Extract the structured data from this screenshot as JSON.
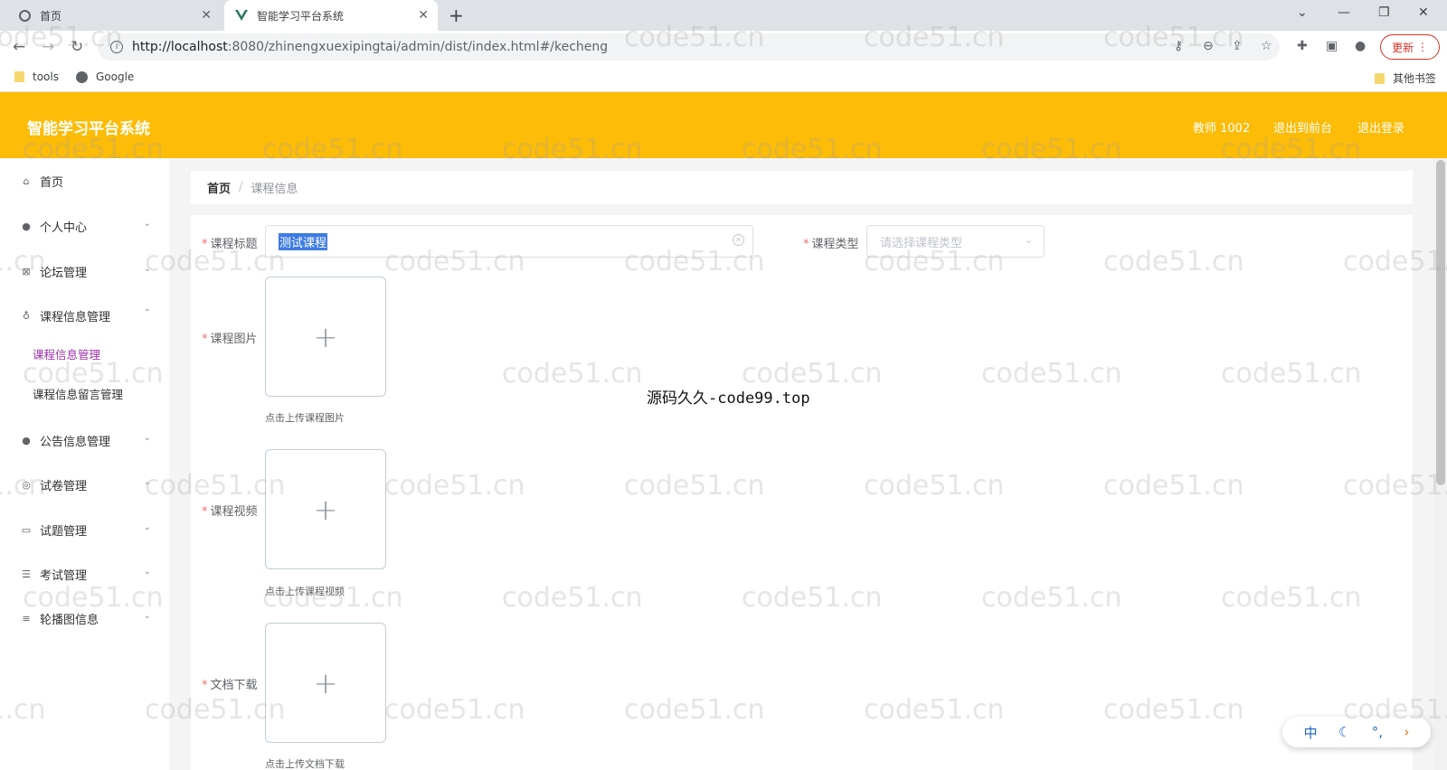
{
  "browser": {
    "tabs": [
      {
        "title": "首页"
      },
      {
        "title": "智能学习平台系统"
      }
    ],
    "url_host": "http://localhost",
    "url_path": ":8080/zhinengxuexipingtai/admin/dist/index.html#/kecheng",
    "update_label": "更新",
    "bookmarks": [
      {
        "label": "tools",
        "icon": "folder-icon"
      },
      {
        "label": "Google",
        "icon": "globe-icon"
      }
    ],
    "other_bookmarks": "其他书签"
  },
  "header": {
    "title": "智能学习平台系统",
    "user": "教师 1002",
    "to_front": "退出到前台",
    "logout": "退出登录",
    "bg_color": "#fcbc07"
  },
  "sidebar": {
    "items": [
      {
        "label": "首页",
        "icon": "home-icon"
      },
      {
        "label": "个人中心",
        "icon": "user-icon"
      },
      {
        "label": "论坛管理",
        "icon": "forum-icon"
      },
      {
        "label": "课程信息管理",
        "icon": "microphone-icon"
      },
      {
        "label": "公告信息管理",
        "icon": "user-icon"
      },
      {
        "label": "试卷管理",
        "icon": "document-icon"
      },
      {
        "label": "试题管理",
        "icon": "chat-icon"
      },
      {
        "label": "考试管理",
        "icon": "sliders-icon"
      },
      {
        "label": "轮播图信息",
        "icon": "list-icon"
      }
    ],
    "sub_items": [
      {
        "label": "课程信息管理"
      },
      {
        "label": "课程信息留言管理"
      }
    ]
  },
  "breadcrumb": {
    "home": "首页",
    "current": "课程信息"
  },
  "form": {
    "title_label": "课程标题",
    "title_value": "测试课程",
    "type_label": "课程类型",
    "type_placeholder": "请选择课程类型",
    "image_label": "课程图片",
    "image_tip": "点击上传课程图片",
    "video_label": "课程视频",
    "video_tip": "点击上传课程视频",
    "doc_label": "文档下载",
    "doc_tip": "点击上传文档下载"
  },
  "overlay": "源码久久-code99.top",
  "watermark": "code51.cn",
  "ime": {
    "mode": "中"
  }
}
